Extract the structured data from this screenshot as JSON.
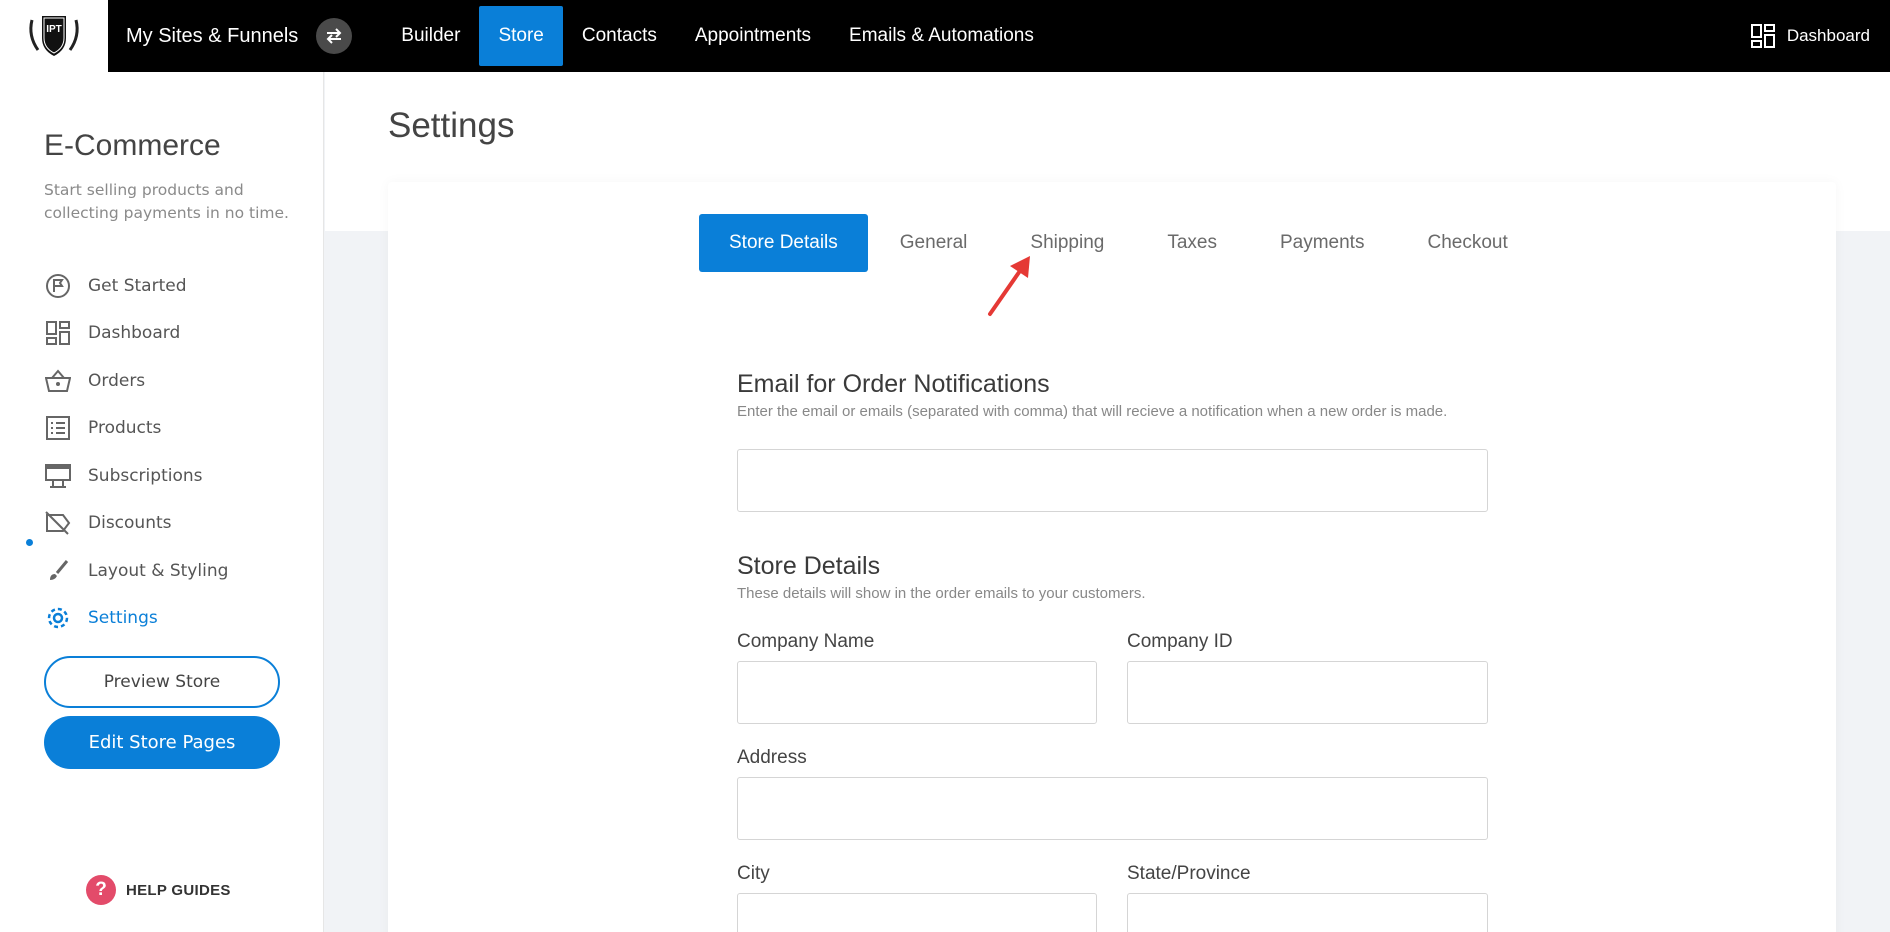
{
  "topbar": {
    "site_title": "My Sites & Funnels",
    "nav": [
      "Builder",
      "Store",
      "Contacts",
      "Appointments",
      "Emails & Automations"
    ],
    "active_nav": "Store",
    "right_label": "Dashboard",
    "logo_text": "IPT"
  },
  "sidebar": {
    "title": "E-Commerce",
    "subtitle": "Start selling products and collecting payments in no time.",
    "items": [
      {
        "label": "Get Started",
        "icon": "get-started-icon"
      },
      {
        "label": "Dashboard",
        "icon": "dashboard-icon"
      },
      {
        "label": "Orders",
        "icon": "basket-icon"
      },
      {
        "label": "Products",
        "icon": "list-icon"
      },
      {
        "label": "Subscriptions",
        "icon": "subscriptions-icon"
      },
      {
        "label": "Discounts",
        "icon": "discount-icon"
      },
      {
        "label": "Layout & Styling",
        "icon": "brush-icon"
      },
      {
        "label": "Settings",
        "icon": "gear-icon"
      }
    ],
    "active_item": "Settings",
    "preview_button": "Preview Store",
    "edit_button": "Edit Store Pages",
    "help_label": "HELP GUIDES"
  },
  "main": {
    "page_title": "Settings",
    "tabs": [
      "Store Details",
      "General",
      "Shipping",
      "Taxes",
      "Payments",
      "Checkout"
    ],
    "active_tab": "Store Details",
    "email_section": {
      "title": "Email for Order Notifications",
      "description": "Enter the email or emails (separated with comma) that will recieve a notification when a new order is made.",
      "value": ""
    },
    "store_section": {
      "title": "Store Details",
      "description": "These details will show in the order emails to your customers.",
      "fields": {
        "company_name": {
          "label": "Company Name",
          "value": ""
        },
        "company_id": {
          "label": "Company ID",
          "value": ""
        },
        "address": {
          "label": "Address",
          "value": ""
        },
        "city": {
          "label": "City",
          "value": ""
        },
        "state": {
          "label": "State/Province",
          "value": ""
        }
      }
    }
  },
  "colors": {
    "accent": "#0a7fd8",
    "topbar": "#000000",
    "arrow": "#e53935",
    "help": "#e34b6a"
  }
}
